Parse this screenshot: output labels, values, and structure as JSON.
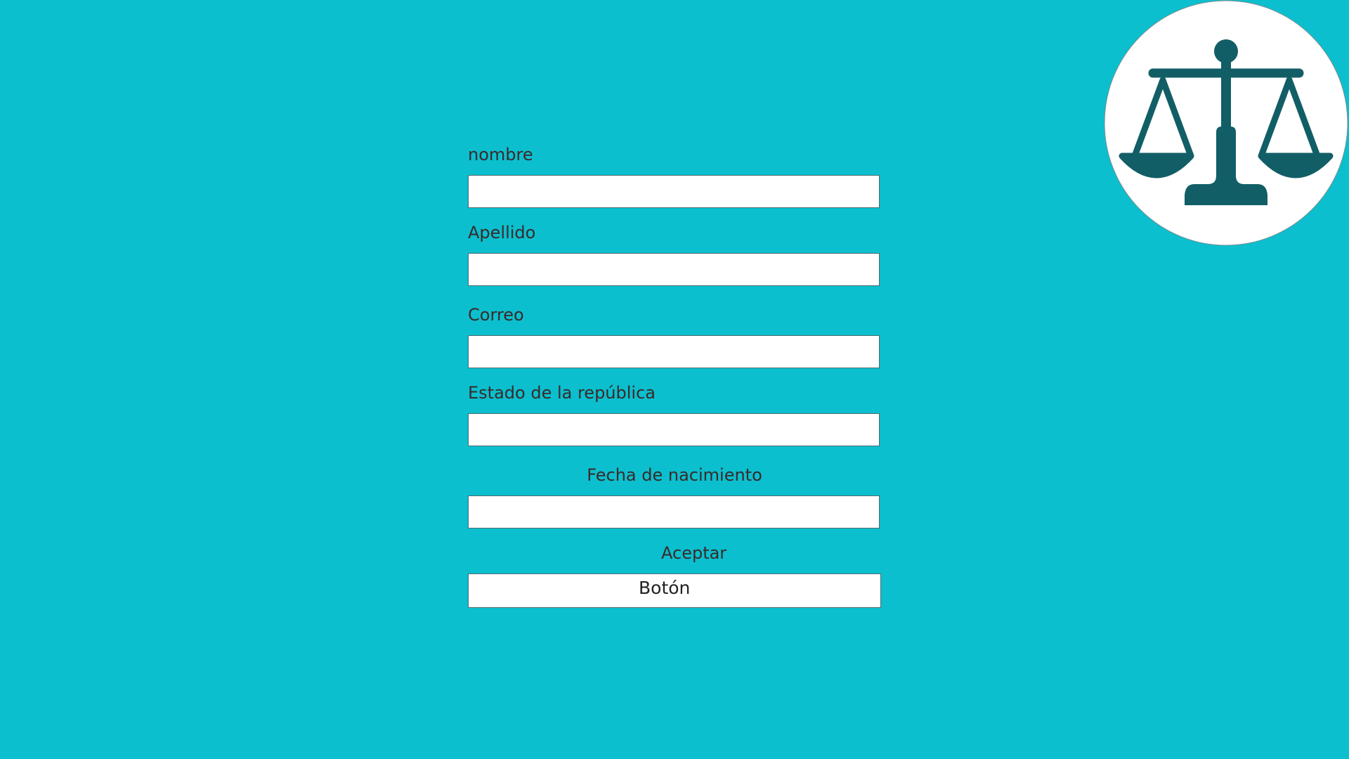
{
  "form": {
    "nombre_label": "nombre",
    "nombre_value": "",
    "apellido_label": "Apellido",
    "apellido_value": "",
    "correo_label": "Correo",
    "correo_value": "",
    "estado_label": "Estado de la república",
    "estado_value": "",
    "fecha_label": "Fecha de nacimiento",
    "fecha_value": "",
    "aceptar_label": "Aceptar",
    "button_label": "Botón"
  },
  "logo": {
    "icon": "scales-of-justice-icon",
    "icon_color": "#125e66",
    "background_color": "#ffffff"
  },
  "colors": {
    "background": "#0bbfce",
    "label_text": "#3a2a2a",
    "field_border": "#4e6c70"
  }
}
